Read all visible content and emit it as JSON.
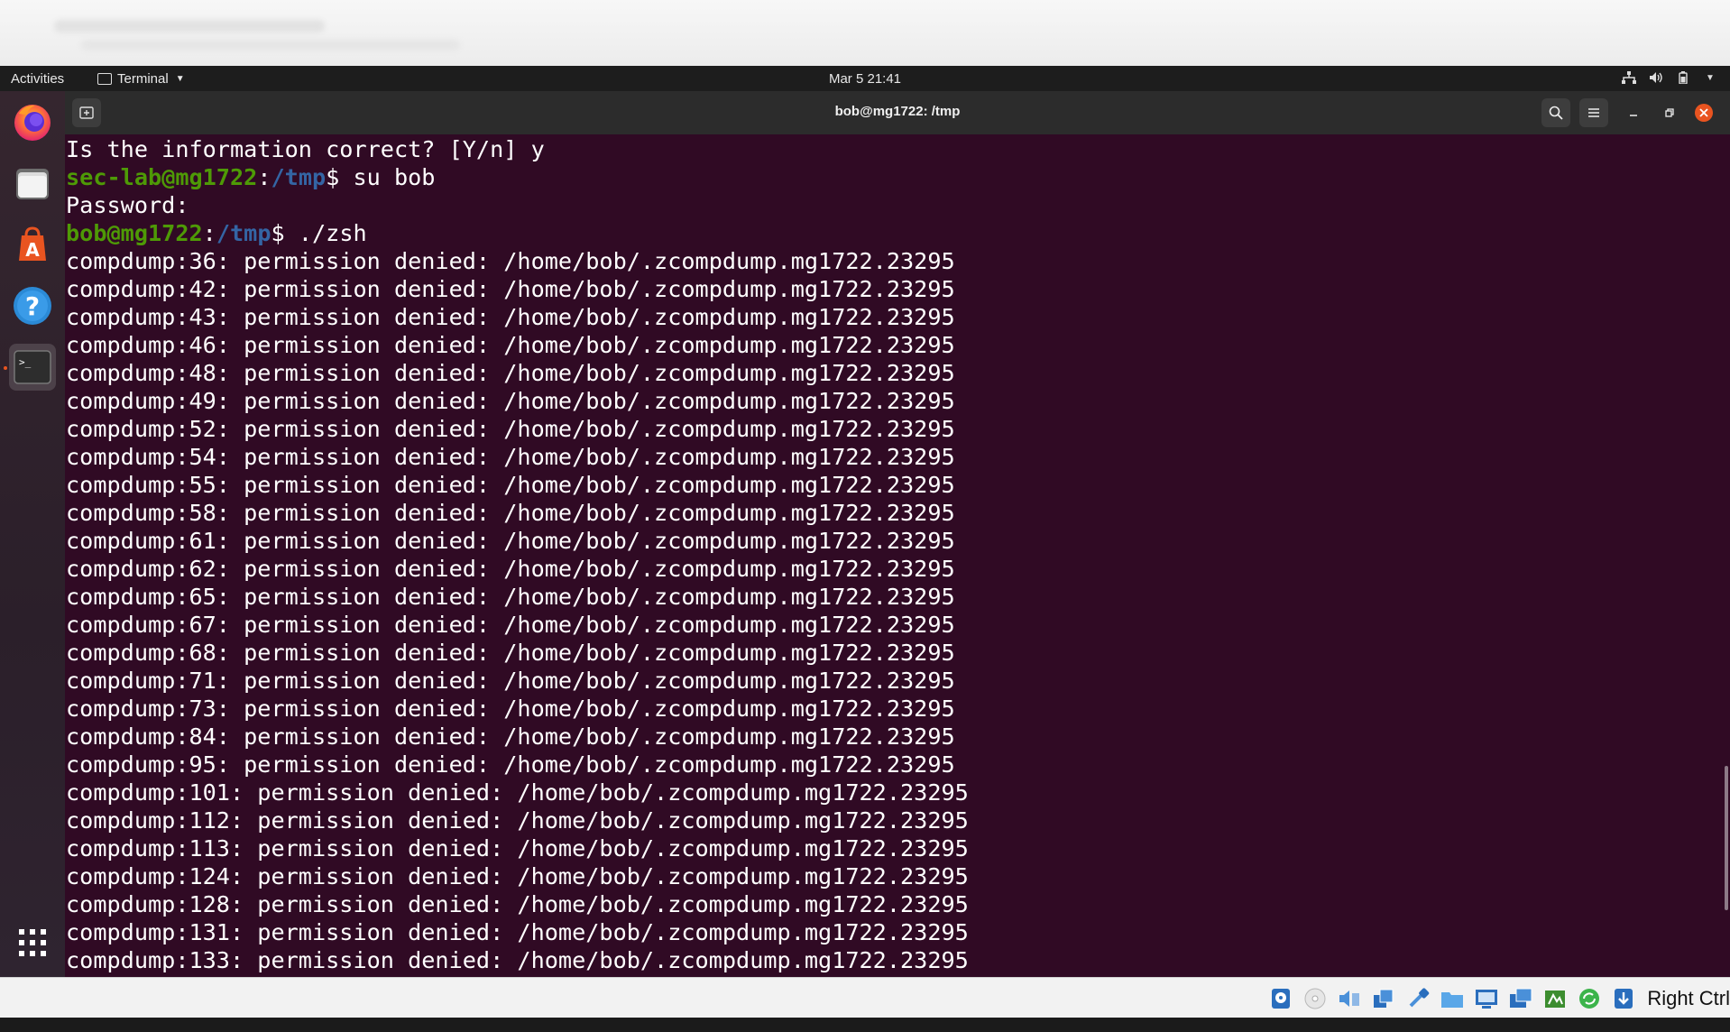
{
  "gnome_bar": {
    "activities": "Activities",
    "app_menu_label": "Terminal",
    "clock": "Mar 5  21:41"
  },
  "dock": {
    "items": [
      {
        "icon": "firefox-icon"
      },
      {
        "icon": "files-icon"
      },
      {
        "icon": "app-center-icon"
      },
      {
        "icon": "help-icon"
      },
      {
        "icon": "terminal-icon",
        "active": true
      },
      {
        "icon": "show-apps-icon"
      }
    ]
  },
  "terminal": {
    "title": "bob@mg1722: /tmp",
    "lines": [
      {
        "segments": [
          {
            "text": "Is the information correct? [Y/n] y"
          }
        ]
      },
      {
        "segments": [
          {
            "text": "sec-lab@mg1722",
            "style": "pc"
          },
          {
            "text": ":"
          },
          {
            "text": "/tmp",
            "style": "pp"
          },
          {
            "text": "$ su bob"
          }
        ]
      },
      {
        "segments": [
          {
            "text": "Password:"
          }
        ]
      },
      {
        "segments": [
          {
            "text": "bob@mg1722",
            "style": "pc"
          },
          {
            "text": ":"
          },
          {
            "text": "/tmp",
            "style": "pp"
          },
          {
            "text": "$ ./zsh"
          }
        ]
      },
      {
        "segments": [
          {
            "text": "compdump:36: permission denied: /home/bob/.zcompdump.mg1722.23295"
          }
        ]
      },
      {
        "segments": [
          {
            "text": "compdump:42: permission denied: /home/bob/.zcompdump.mg1722.23295"
          }
        ]
      },
      {
        "segments": [
          {
            "text": "compdump:43: permission denied: /home/bob/.zcompdump.mg1722.23295"
          }
        ]
      },
      {
        "segments": [
          {
            "text": "compdump:46: permission denied: /home/bob/.zcompdump.mg1722.23295"
          }
        ]
      },
      {
        "segments": [
          {
            "text": "compdump:48: permission denied: /home/bob/.zcompdump.mg1722.23295"
          }
        ]
      },
      {
        "segments": [
          {
            "text": "compdump:49: permission denied: /home/bob/.zcompdump.mg1722.23295"
          }
        ]
      },
      {
        "segments": [
          {
            "text": "compdump:52: permission denied: /home/bob/.zcompdump.mg1722.23295"
          }
        ]
      },
      {
        "segments": [
          {
            "text": "compdump:54: permission denied: /home/bob/.zcompdump.mg1722.23295"
          }
        ]
      },
      {
        "segments": [
          {
            "text": "compdump:55: permission denied: /home/bob/.zcompdump.mg1722.23295"
          }
        ]
      },
      {
        "segments": [
          {
            "text": "compdump:58: permission denied: /home/bob/.zcompdump.mg1722.23295"
          }
        ]
      },
      {
        "segments": [
          {
            "text": "compdump:61: permission denied: /home/bob/.zcompdump.mg1722.23295"
          }
        ]
      },
      {
        "segments": [
          {
            "text": "compdump:62: permission denied: /home/bob/.zcompdump.mg1722.23295"
          }
        ]
      },
      {
        "segments": [
          {
            "text": "compdump:65: permission denied: /home/bob/.zcompdump.mg1722.23295"
          }
        ]
      },
      {
        "segments": [
          {
            "text": "compdump:67: permission denied: /home/bob/.zcompdump.mg1722.23295"
          }
        ]
      },
      {
        "segments": [
          {
            "text": "compdump:68: permission denied: /home/bob/.zcompdump.mg1722.23295"
          }
        ]
      },
      {
        "segments": [
          {
            "text": "compdump:71: permission denied: /home/bob/.zcompdump.mg1722.23295"
          }
        ]
      },
      {
        "segments": [
          {
            "text": "compdump:73: permission denied: /home/bob/.zcompdump.mg1722.23295"
          }
        ]
      },
      {
        "segments": [
          {
            "text": "compdump:84: permission denied: /home/bob/.zcompdump.mg1722.23295"
          }
        ]
      },
      {
        "segments": [
          {
            "text": "compdump:95: permission denied: /home/bob/.zcompdump.mg1722.23295"
          }
        ]
      },
      {
        "segments": [
          {
            "text": "compdump:101: permission denied: /home/bob/.zcompdump.mg1722.23295"
          }
        ]
      },
      {
        "segments": [
          {
            "text": "compdump:112: permission denied: /home/bob/.zcompdump.mg1722.23295"
          }
        ]
      },
      {
        "segments": [
          {
            "text": "compdump:113: permission denied: /home/bob/.zcompdump.mg1722.23295"
          }
        ]
      },
      {
        "segments": [
          {
            "text": "compdump:124: permission denied: /home/bob/.zcompdump.mg1722.23295"
          }
        ]
      },
      {
        "segments": [
          {
            "text": "compdump:128: permission denied: /home/bob/.zcompdump.mg1722.23295"
          }
        ]
      },
      {
        "segments": [
          {
            "text": "compdump:131: permission denied: /home/bob/.zcompdump.mg1722.23295"
          }
        ]
      },
      {
        "segments": [
          {
            "text": "compdump:133: permission denied: /home/bob/.zcompdump.mg1722.23295"
          }
        ]
      }
    ]
  },
  "vbox_status": {
    "icons": [
      "hard-disk-icon",
      "optical-drive-icon",
      "audio-icon",
      "network-icon",
      "usb-icon",
      "shared-folders-icon",
      "display-icon",
      "video-capture-icon",
      "recording-icon",
      "cpu-icon",
      "mouse-integration-icon"
    ],
    "host_key": "Right Ctrl"
  },
  "colors": {
    "terminal_bg": "#300a24",
    "prompt_user": "#4e9a06",
    "prompt_path": "#3465a4",
    "close_button": "#e95420"
  }
}
